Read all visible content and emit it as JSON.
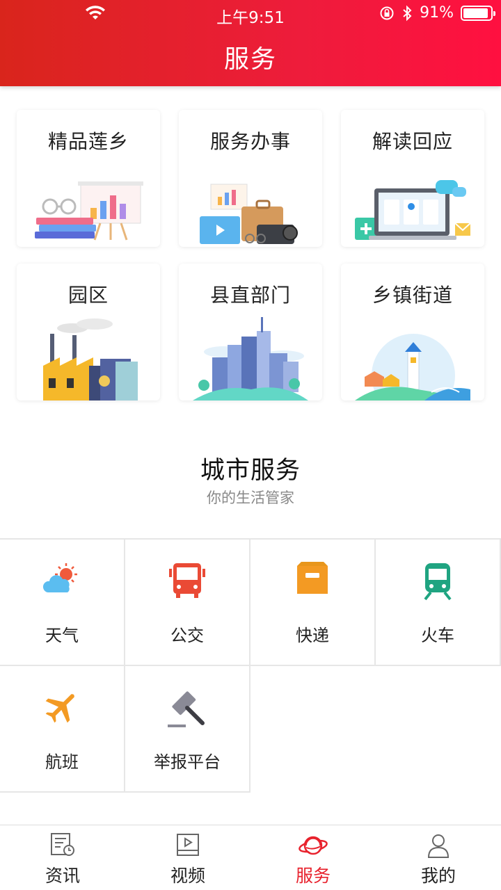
{
  "status_bar": {
    "time": "上午9:51",
    "battery": "91%",
    "battery_level": 0.91
  },
  "header": {
    "title": "服务"
  },
  "cards": [
    {
      "label": "精品莲乡",
      "icon": "books-chart-illustration"
    },
    {
      "label": "服务办事",
      "icon": "briefcase-illustration"
    },
    {
      "label": "解读回应",
      "icon": "laptop-chat-illustration"
    },
    {
      "label": "园区",
      "icon": "factory-illustration"
    },
    {
      "label": "县直部门",
      "icon": "city-buildings-illustration"
    },
    {
      "label": "乡镇街道",
      "icon": "town-lighthouse-illustration"
    }
  ],
  "city_service": {
    "title": "城市服务",
    "subtitle": "你的生活管家",
    "items": [
      {
        "label": "天气",
        "icon": "weather-icon"
      },
      {
        "label": "公交",
        "icon": "bus-icon"
      },
      {
        "label": "快递",
        "icon": "express-box-icon"
      },
      {
        "label": "火车",
        "icon": "train-icon"
      },
      {
        "label": "航班",
        "icon": "airplane-icon"
      },
      {
        "label": "举报平台",
        "icon": "gavel-icon"
      }
    ]
  },
  "tabbar": {
    "active": "服务",
    "items": [
      {
        "label": "资讯",
        "icon": "news-icon"
      },
      {
        "label": "视频",
        "icon": "video-icon"
      },
      {
        "label": "服务",
        "icon": "planet-icon"
      },
      {
        "label": "我的",
        "icon": "user-icon"
      }
    ]
  },
  "colors": {
    "brand_red": "#e8222d",
    "header_start": "#d9251c",
    "header_end": "#ff1040"
  }
}
